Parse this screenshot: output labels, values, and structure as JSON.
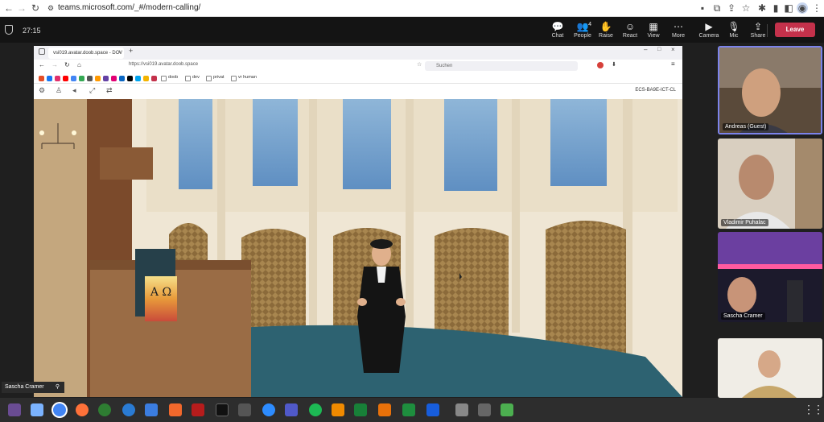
{
  "browser": {
    "url": "teams.microsoft.com/_#/modern-calling/"
  },
  "teams": {
    "timer": "27:15",
    "toolbar": [
      {
        "label": "Chat",
        "icon": "chat-icon",
        "glyph": "💬"
      },
      {
        "label": "People",
        "icon": "people-icon",
        "glyph": "👥",
        "badge": "4"
      },
      {
        "label": "Raise",
        "icon": "raise-hand-icon",
        "glyph": "✋"
      },
      {
        "label": "React",
        "icon": "react-icon",
        "glyph": "☺"
      },
      {
        "label": "View",
        "icon": "view-icon",
        "glyph": "▦"
      },
      {
        "label": "More",
        "icon": "more-icon",
        "glyph": "⋯"
      },
      {
        "label": "Camera",
        "icon": "camera-icon",
        "glyph": "▶"
      },
      {
        "label": "Mic",
        "icon": "mic-icon",
        "glyph": "🎙"
      },
      {
        "label": "Share",
        "icon": "share-icon",
        "glyph": "⇪"
      }
    ],
    "leave_label": "Leave",
    "leave_color": "#c4314b"
  },
  "shared_window": {
    "tab_title": "vsi019.avatar.doob.space - DCV",
    "url": "https://vsi019.avatar.doob.space",
    "search_placeholder": "Suchen",
    "bookmarks": [
      "doob",
      "dev",
      "privat",
      "vr human"
    ],
    "scene_id": "ECS-BA9E-ICT-CL",
    "pulpit_symbols": "Α Ω"
  },
  "participants": [
    {
      "name": "Andreas (Guest)"
    },
    {
      "name": "Vladimir Puhalac"
    },
    {
      "name": "Sascha Cramer"
    },
    {
      "name": ""
    }
  ],
  "self_view_label": "Sascha Cramer"
}
